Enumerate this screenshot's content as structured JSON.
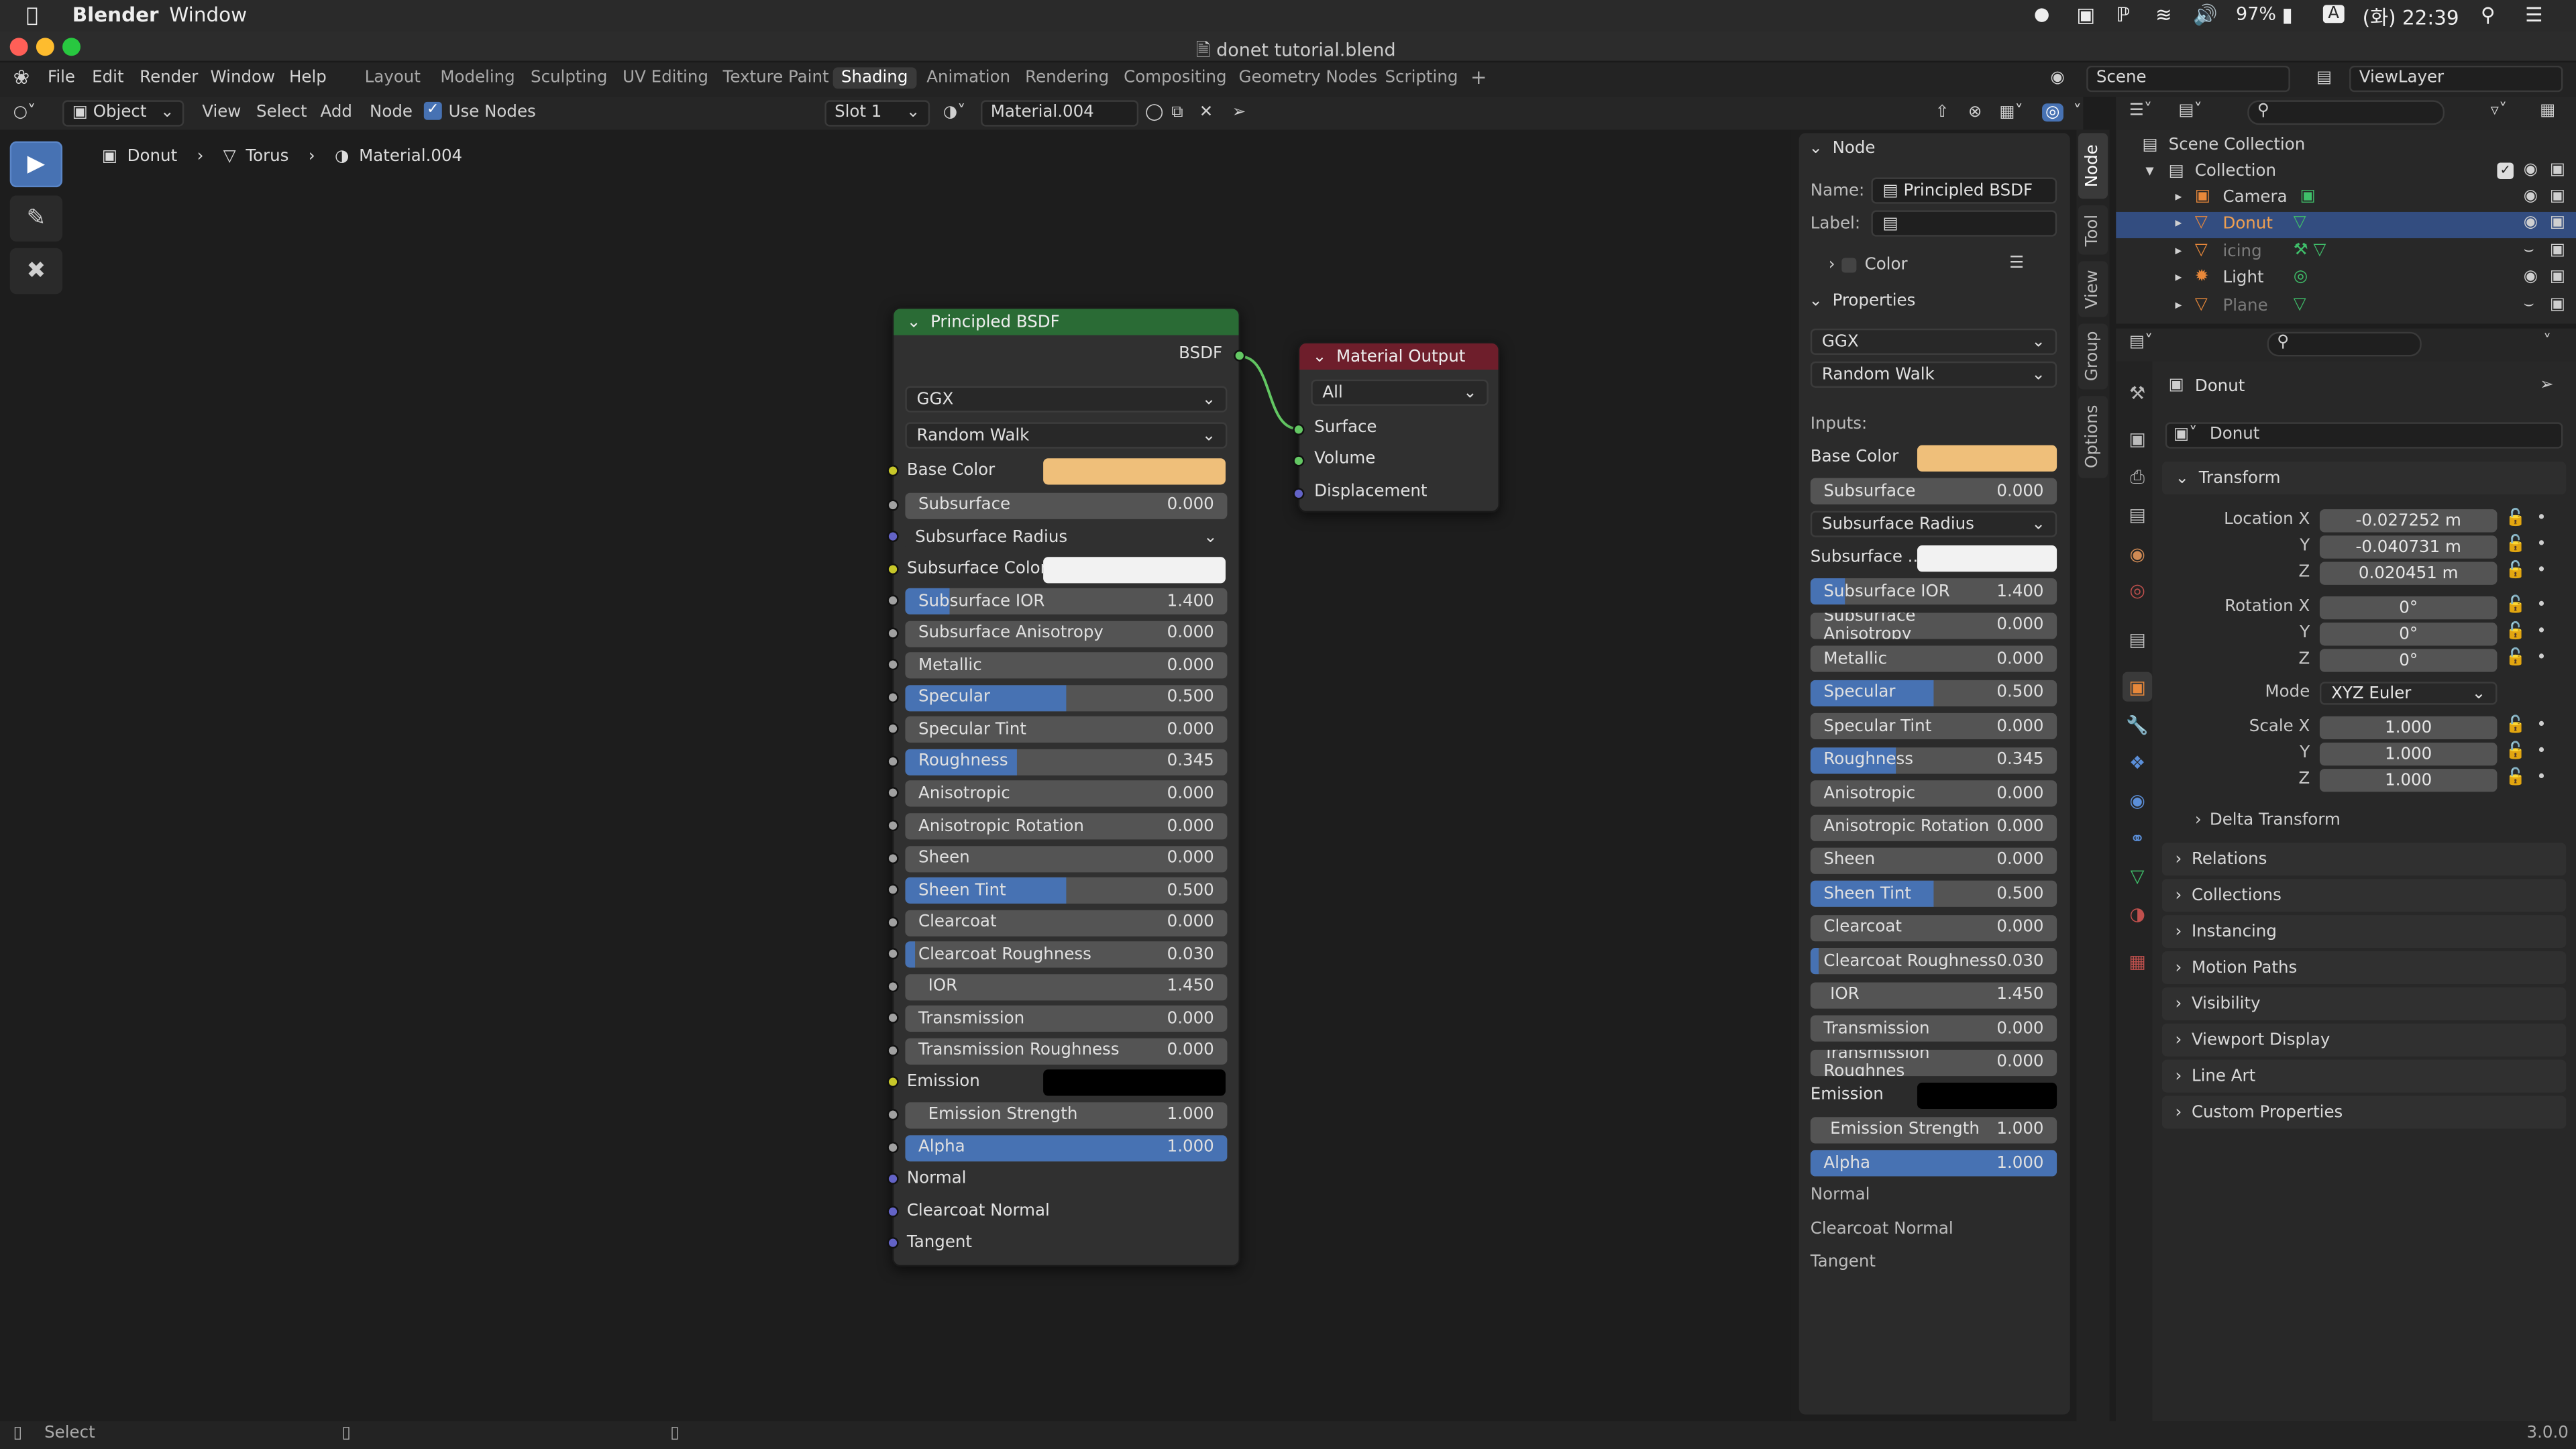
{
  "macbar": {
    "app": "Blender",
    "menu": "Window",
    "battery": "97%",
    "input_badge": "A",
    "clock": "(화) 22:39"
  },
  "window": {
    "title": "donet tutorial.blend"
  },
  "menu": {
    "items": [
      "File",
      "Edit",
      "Render",
      "Window",
      "Help"
    ]
  },
  "workspaces": {
    "items": [
      "Layout",
      "Modeling",
      "Sculpting",
      "UV Editing",
      "Texture Paint",
      "Shading",
      "Animation",
      "Rendering",
      "Compositing",
      "Geometry Nodes",
      "Scripting"
    ],
    "active": "Shading",
    "add": "+"
  },
  "scene": {
    "scene": "Scene",
    "view_layer": "ViewLayer"
  },
  "header": {
    "mode": "Object",
    "view": "View",
    "select": "Select",
    "add": "Add",
    "node": "Node",
    "use_nodes": "Use Nodes",
    "slot": "Slot 1",
    "material": "Material.004"
  },
  "breadcrumb": {
    "object": "Donut",
    "mesh": "Torus",
    "material": "Material.004"
  },
  "principled": {
    "title": "Principled BSDF",
    "output": "BSDF",
    "distribution": "GGX",
    "subsurface_method": "Random Walk",
    "base_color_label": "Base Color",
    "base_color": "#efbf7a",
    "subsurface_color_label": "Subsurface Color",
    "subsurface_color": "#f2f2f2",
    "subsurface_radius": "Subsurface Radius",
    "emission_label": "Emission",
    "emission_color": "#000000",
    "fields": [
      {
        "label": "Subsurface",
        "value": "0.000",
        "fill": 0
      },
      {
        "label": "Subsurface IOR",
        "value": "1.400",
        "fill": 0.14
      },
      {
        "label": "Subsurface Anisotropy",
        "value": "0.000",
        "fill": 0
      },
      {
        "label": "Metallic",
        "value": "0.000",
        "fill": 0
      },
      {
        "label": "Specular",
        "value": "0.500",
        "fill": 0.5
      },
      {
        "label": "Specular Tint",
        "value": "0.000",
        "fill": 0
      },
      {
        "label": "Roughness",
        "value": "0.345",
        "fill": 0.345
      },
      {
        "label": "Anisotropic",
        "value": "0.000",
        "fill": 0
      },
      {
        "label": "Anisotropic Rotation",
        "value": "0.000",
        "fill": 0
      },
      {
        "label": "Sheen",
        "value": "0.000",
        "fill": 0
      },
      {
        "label": "Sheen Tint",
        "value": "0.500",
        "fill": 0.5
      },
      {
        "label": "Clearcoat",
        "value": "0.000",
        "fill": 0
      },
      {
        "label": "Clearcoat Roughness",
        "value": "0.030",
        "fill": 0.03
      },
      {
        "label": "IOR",
        "value": "1.450",
        "fill": 0
      },
      {
        "label": "Transmission",
        "value": "0.000",
        "fill": 0
      },
      {
        "label": "Transmission Roughness",
        "value": "0.000",
        "fill": 0
      },
      {
        "label": "Emission Strength",
        "value": "1.000",
        "fill": 0
      },
      {
        "label": "Alpha",
        "value": "1.000",
        "fill": 1
      }
    ],
    "sockets_bottom": [
      "Normal",
      "Clearcoat Normal",
      "Tangent"
    ]
  },
  "material_output": {
    "title": "Material Output",
    "target": "All",
    "inputs": [
      "Surface",
      "Volume",
      "Displacement"
    ]
  },
  "npanel": {
    "node_section": "Node",
    "name_label": "Name:",
    "name_value": "Principled BSDF",
    "label_label": "Label:",
    "color": "Color",
    "properties": "Properties",
    "distribution": "GGX",
    "subsurface_method": "Random Walk",
    "inputs": "Inputs:",
    "base_color_label": "Base Color",
    "subsurface_color_label": "Subsurface ...",
    "subsurface_radius": "Subsurface Radius",
    "emission_label": "Emission",
    "transmission_roughness_label": "Transmission Roughnes",
    "fields": [
      {
        "label": "Subsurface",
        "value": "0.000",
        "fill": 0
      },
      {
        "label": "Subsurface IOR",
        "value": "1.400",
        "fill": 0.14
      },
      {
        "label": "Subsurface Anisotropy",
        "value": "0.000",
        "fill": 0
      },
      {
        "label": "Metallic",
        "value": "0.000",
        "fill": 0
      },
      {
        "label": "Specular",
        "value": "0.500",
        "fill": 0.5
      },
      {
        "label": "Specular Tint",
        "value": "0.000",
        "fill": 0
      },
      {
        "label": "Roughness",
        "value": "0.345",
        "fill": 0.345
      },
      {
        "label": "Anisotropic",
        "value": "0.000",
        "fill": 0
      },
      {
        "label": "Anisotropic Rotation",
        "value": "0.000",
        "fill": 0
      },
      {
        "label": "Sheen",
        "value": "0.000",
        "fill": 0
      },
      {
        "label": "Sheen Tint",
        "value": "0.500",
        "fill": 0.5
      },
      {
        "label": "Clearcoat",
        "value": "0.000",
        "fill": 0
      },
      {
        "label": "Clearcoat Roughness",
        "value": "0.030",
        "fill": 0.03
      },
      {
        "label": "IOR",
        "value": "1.450",
        "fill": 0
      },
      {
        "label": "Transmission",
        "value": "0.000",
        "fill": 0
      },
      {
        "label": "Transmission Roughnes",
        "value": "0.000",
        "fill": 0
      },
      {
        "label": "Emission Strength",
        "value": "1.000",
        "fill": 0
      },
      {
        "label": "Alpha",
        "value": "1.000",
        "fill": 1
      }
    ],
    "sockets_bottom": [
      "Normal",
      "Clearcoat Normal",
      "Tangent"
    ]
  },
  "sidebar_tabs": [
    "Node",
    "Tool",
    "View",
    "Group",
    "Options"
  ],
  "outliner": {
    "scene_collection": "Scene Collection",
    "collection": "Collection",
    "items": [
      {
        "name": "Camera",
        "selected": false,
        "dim": false
      },
      {
        "name": "Donut",
        "selected": true,
        "dim": false
      },
      {
        "name": "icing",
        "selected": false,
        "dim": true
      },
      {
        "name": "Light",
        "selected": false,
        "dim": false
      },
      {
        "name": "Plane",
        "selected": false,
        "dim": true
      }
    ]
  },
  "properties": {
    "object_name": "Donut",
    "object_field": "Donut",
    "transform": "Transform",
    "location_label": "Location X",
    "rotation_label": "Rotation X",
    "scale_label": "Scale X",
    "y": "Y",
    "z": "Z",
    "location": [
      "-0.027252 m",
      "-0.040731 m",
      "0.020451 m"
    ],
    "rotation": [
      "0°",
      "0°",
      "0°"
    ],
    "mode_label": "Mode",
    "mode": "XYZ Euler",
    "scale": [
      "1.000",
      "1.000",
      "1.000"
    ],
    "delta": "Delta Transform",
    "sections": [
      "Relations",
      "Collections",
      "Instancing",
      "Motion Paths",
      "Visibility",
      "Viewport Display",
      "Line Art",
      "Custom Properties"
    ]
  },
  "status": {
    "left": "Select",
    "version": "3.0.0"
  }
}
